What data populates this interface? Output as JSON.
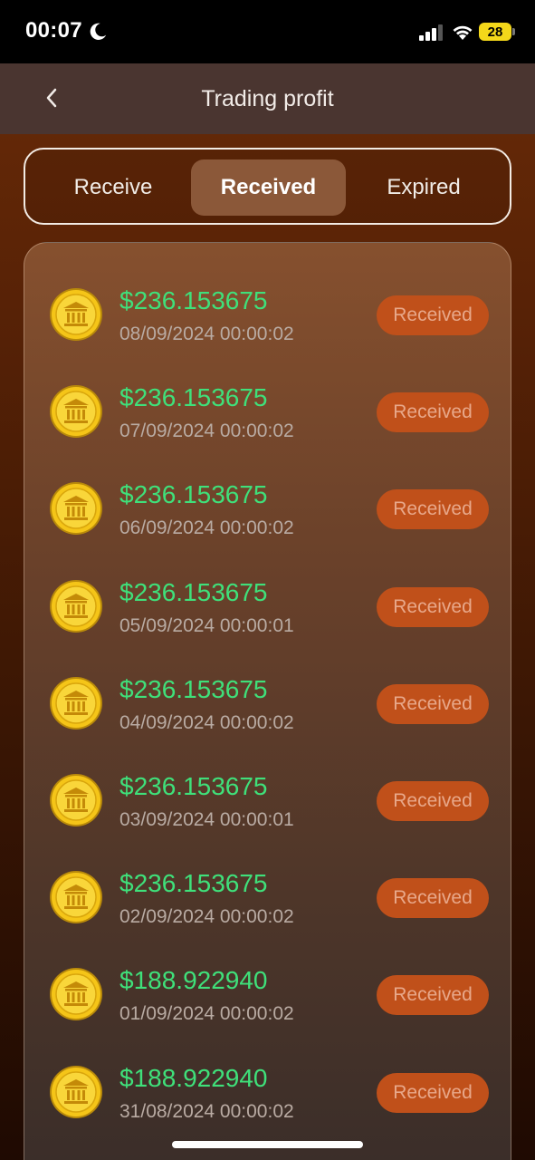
{
  "status_bar": {
    "time": "00:07",
    "battery": "28"
  },
  "header": {
    "title": "Trading profit"
  },
  "tabs": [
    {
      "label": "Receive",
      "active": false
    },
    {
      "label": "Received",
      "active": true
    },
    {
      "label": "Expired",
      "active": false
    }
  ],
  "items": [
    {
      "amount": "$236.153675",
      "date": "08/09/2024 00:00:02",
      "status": "Received"
    },
    {
      "amount": "$236.153675",
      "date": "07/09/2024 00:00:02",
      "status": "Received"
    },
    {
      "amount": "$236.153675",
      "date": "06/09/2024 00:00:02",
      "status": "Received"
    },
    {
      "amount": "$236.153675",
      "date": "05/09/2024 00:00:01",
      "status": "Received"
    },
    {
      "amount": "$236.153675",
      "date": "04/09/2024 00:00:02",
      "status": "Received"
    },
    {
      "amount": "$236.153675",
      "date": "03/09/2024 00:00:01",
      "status": "Received"
    },
    {
      "amount": "$236.153675",
      "date": "02/09/2024 00:00:02",
      "status": "Received"
    },
    {
      "amount": "$188.922940",
      "date": "01/09/2024 00:00:02",
      "status": "Received"
    },
    {
      "amount": "$188.922940",
      "date": "31/08/2024 00:00:02",
      "status": "Received"
    }
  ],
  "colors": {
    "amount": "#3fe07a",
    "status_pill": "#c0501a",
    "accent_tab": "#8b5839"
  },
  "icons": [
    "moon-icon",
    "signal-icon",
    "wifi-icon",
    "battery-icon",
    "back-chevron-icon",
    "coin-icon"
  ]
}
